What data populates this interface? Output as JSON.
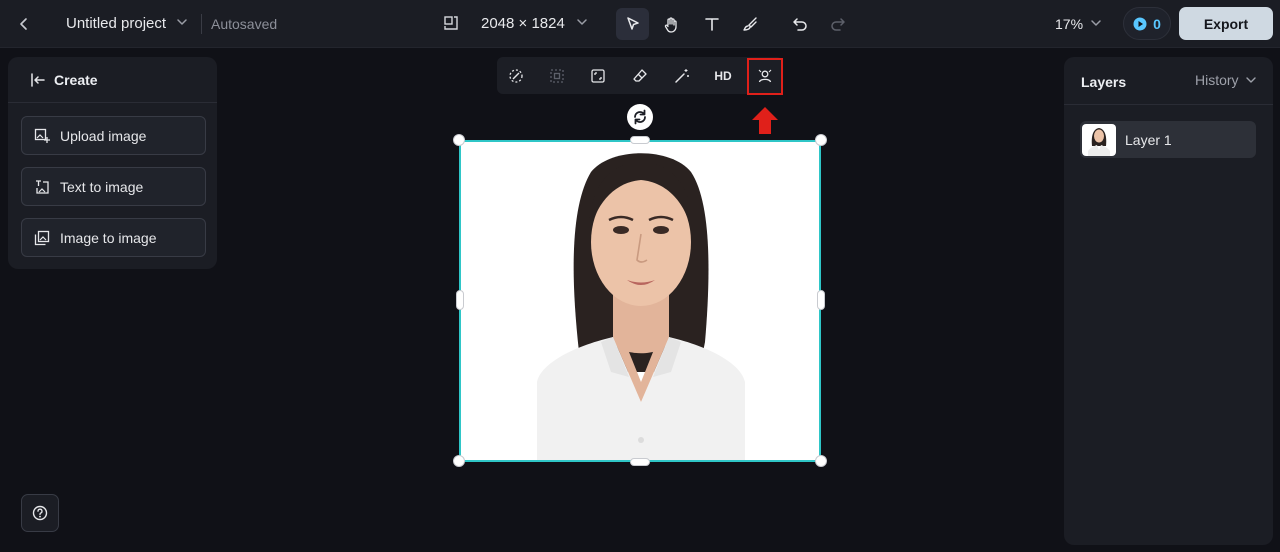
{
  "topbar": {
    "project_title": "Untitled project",
    "save_status": "Autosaved",
    "canvas_size": "2048 × 1824",
    "zoom": "17%",
    "credits": "0",
    "export_label": "Export",
    "tools": [
      "select-tool",
      "hand-tool",
      "text-tool",
      "brush-tool"
    ],
    "active_tool": "select-tool"
  },
  "left_panel": {
    "title": "Create",
    "buttons": [
      {
        "label": "Upload image",
        "icon": "upload-image-icon"
      },
      {
        "label": "Text to image",
        "icon": "text-to-image-icon"
      },
      {
        "label": "Image to image",
        "icon": "image-to-image-icon"
      }
    ]
  },
  "float_toolbar": {
    "tools": [
      "remove-background-icon",
      "expand-icon",
      "crop-icon",
      "eraser-icon",
      "magic-wand-icon",
      "HD",
      "face-retouch-icon"
    ],
    "hd_label": "HD",
    "highlighted_tool": "face-retouch-icon"
  },
  "right_panel": {
    "title": "Layers",
    "history_label": "History",
    "layers": [
      {
        "name": "Layer 1"
      }
    ]
  },
  "colors": {
    "background": "#101117",
    "panel": "#1b1d24",
    "selection": "#2fc6c7",
    "highlight": "#e0201a",
    "credits_accent": "#59c7ff",
    "export_bg": "#cfd9e2"
  }
}
